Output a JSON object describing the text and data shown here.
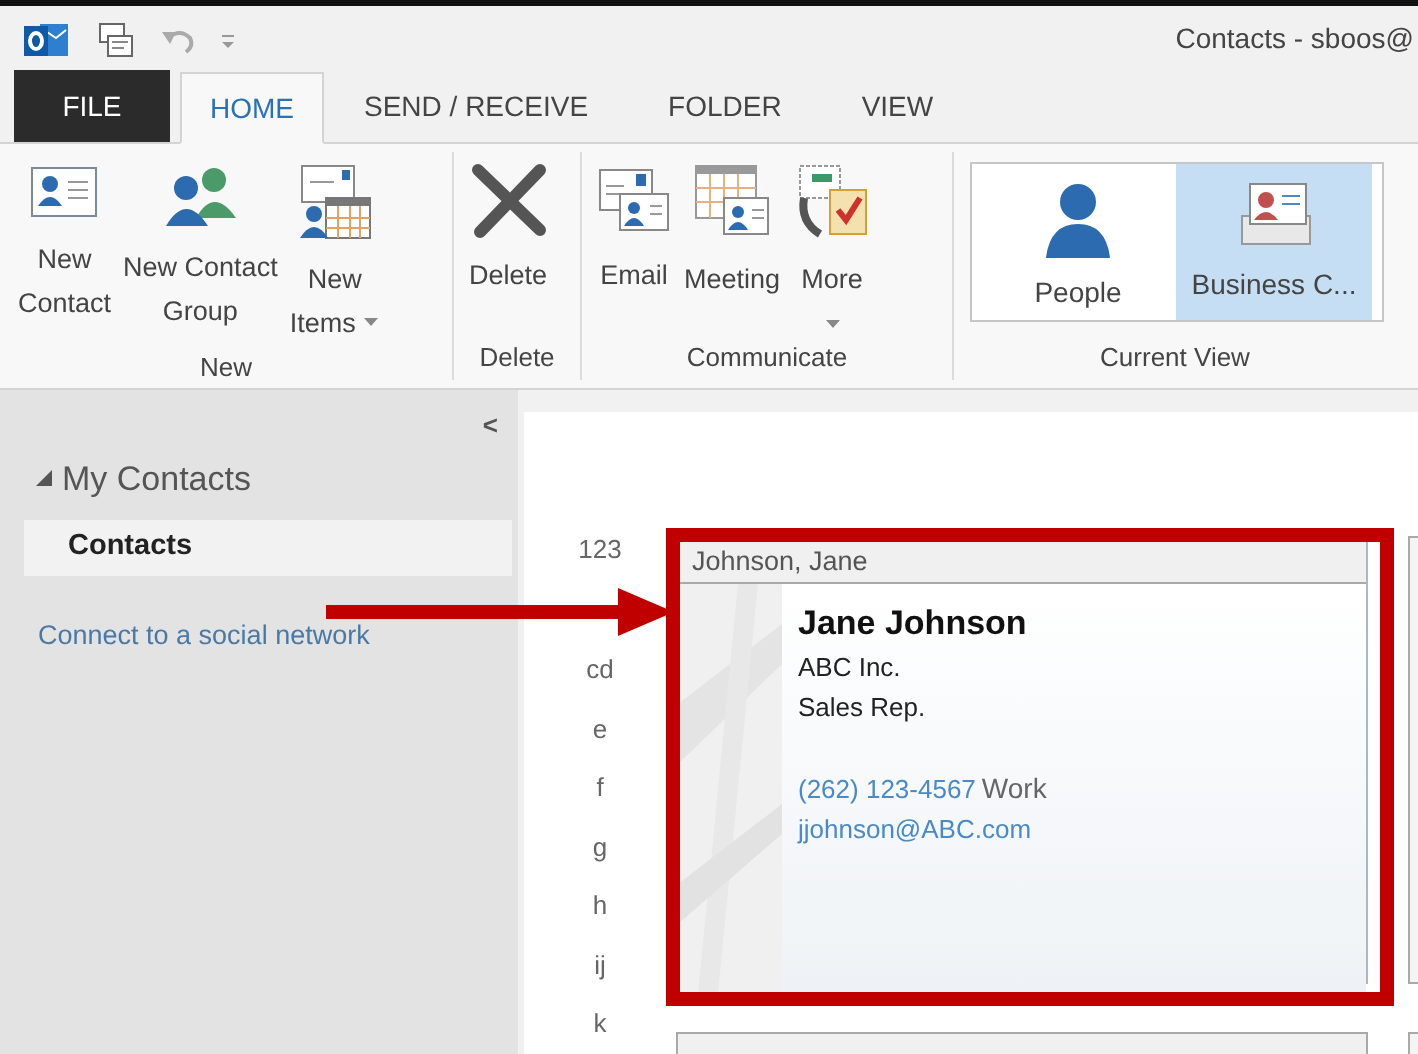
{
  "window": {
    "title": "Contacts - sboos@"
  },
  "tabs": [
    {
      "label": "FILE",
      "kind": "file",
      "selected": false
    },
    {
      "label": "HOME",
      "kind": "tab",
      "selected": true
    },
    {
      "label": "SEND / RECEIVE",
      "kind": "tab",
      "selected": false
    },
    {
      "label": "FOLDER",
      "kind": "tab",
      "selected": false
    },
    {
      "label": "VIEW",
      "kind": "tab",
      "selected": false
    }
  ],
  "ribbon": {
    "groups": [
      {
        "label": "New",
        "kind": "plain",
        "buttons": [
          {
            "lines": [
              "New",
              "Contact"
            ],
            "dropdown": false
          },
          {
            "lines": [
              "New Contact",
              "Group"
            ],
            "dropdown": false
          },
          {
            "lines": [
              "New",
              "Items"
            ],
            "dropdown": true
          }
        ]
      },
      {
        "label": "Delete",
        "kind": "plain",
        "buttons": [
          {
            "lines": [
              "Delete"
            ],
            "dropdown": false
          }
        ]
      },
      {
        "label": "Communicate",
        "kind": "plain",
        "buttons": [
          {
            "lines": [
              "Email"
            ],
            "dropdown": false
          },
          {
            "lines": [
              "Meeting"
            ],
            "dropdown": false
          },
          {
            "lines": [
              "More"
            ],
            "dropdown": true
          }
        ]
      },
      {
        "label": "Current View",
        "kind": "gallery",
        "buttons": [
          {
            "lines": [
              "People"
            ],
            "selected": false
          },
          {
            "lines": [
              "Business C..."
            ],
            "selected": true
          }
        ]
      }
    ]
  },
  "sidebar": {
    "collapse": "<",
    "folders": [
      {
        "label": "My Contacts",
        "expanded": true,
        "children": [
          {
            "label": "Contacts",
            "selected": true
          }
        ]
      }
    ],
    "link": "Connect to a social network"
  },
  "index": [
    "123",
    "cd",
    "e",
    "f",
    "g",
    "h",
    "ij",
    "k"
  ],
  "cards": [
    {
      "header": "Johnson, Jane",
      "name": "Jane Johnson",
      "company": "ABC Inc.",
      "job_title": "Sales Rep.",
      "phone": "(262) 123-4567",
      "phone_label": "Work",
      "email": "jjohnson@ABC.com"
    }
  ],
  "annotations": {
    "highlight_box": true,
    "pointer_arrow": true
  }
}
